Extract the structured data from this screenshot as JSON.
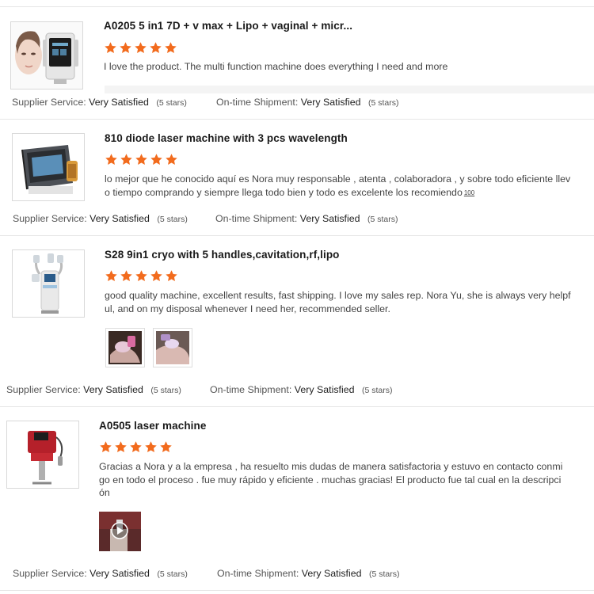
{
  "reviews": [
    {
      "title": "A0205 5 in1 7D + v max + Lipo + vaginal + micr...",
      "rating": 5,
      "text": "I love the product. The multi function machine does everything I need and more",
      "supplier_label": "Supplier Service:",
      "supplier_value": "Very Satisfied",
      "supplier_stars": "(5 stars)",
      "shipment_label": "On-time Shipment:",
      "shipment_value": "Very Satisfied",
      "shipment_stars": "(5 stars)"
    },
    {
      "title": "810 diode laser machine with 3 pcs wavelength",
      "rating": 5,
      "text": "lo mejor que he conocido aquí es Nora muy responsable , atenta , colaboradora , y sobre todo eficiente llev o tiempo comprando y siempre llega todo bien y todo es excelente los recomiendo",
      "translate_label": "100",
      "supplier_label": "Supplier Service:",
      "supplier_value": "Very Satisfied",
      "supplier_stars": "(5 stars)",
      "shipment_label": "On-time Shipment:",
      "shipment_value": "Very Satisfied",
      "shipment_stars": "(5 stars)"
    },
    {
      "title": "S28 9in1 cryo with 5 handles,cavitation,rf,lipo",
      "rating": 5,
      "text": "good quality machine, excellent results, fast shipping. I love my sales rep. Nora Yu, she is always very helpf ul, and on my disposal whenever I need her, recommended seller.",
      "supplier_label": "Supplier Service:",
      "supplier_value": "Very Satisfied",
      "supplier_stars": "(5 stars)",
      "shipment_label": "On-time Shipment:",
      "shipment_value": "Very Satisfied",
      "shipment_stars": "(5 stars)"
    },
    {
      "title": "A0505 laser machine",
      "rating": 5,
      "text": "Gracias a Nora y a la empresa , ha resuelto mis dudas de manera satisfactoria y estuvo en contacto conmi go en todo el proceso . fue muy rápido y eficiente . muchas gracias! El producto fue tal cual en la descripci ón",
      "supplier_label": "Supplier Service:",
      "supplier_value": "Very Satisfied",
      "supplier_stars": "(5 stars)",
      "shipment_label": "On-time Shipment:",
      "shipment_value": "Very Satisfied",
      "shipment_stars": "(5 stars)"
    }
  ],
  "colors": {
    "star": "#f26b1d",
    "separator": "#e6e6e6"
  },
  "icons": {
    "star": "star-icon",
    "play": "play-icon"
  }
}
